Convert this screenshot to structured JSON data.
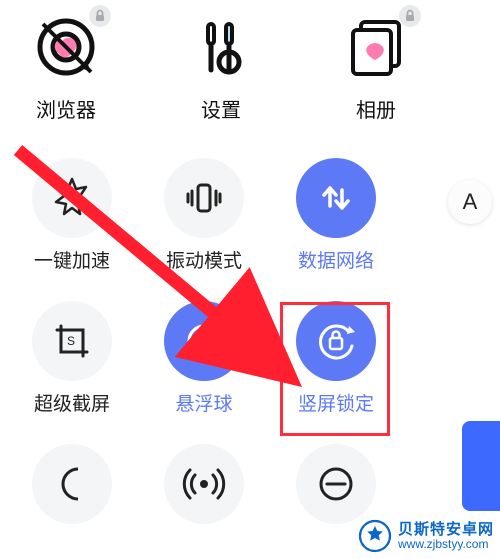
{
  "apps": {
    "browser": {
      "label": "浏览器",
      "locked": true
    },
    "settings": {
      "label": "设置",
      "locked": false
    },
    "gallery": {
      "label": "相册",
      "locked": true
    }
  },
  "toggles": {
    "boost": {
      "label": "一键加速",
      "active": false
    },
    "vibrate": {
      "label": "振动模式",
      "active": false
    },
    "data": {
      "label": "数据网络",
      "active": true
    },
    "screenshot": {
      "label": "超级截屏",
      "active": false
    },
    "float": {
      "label": "悬浮球",
      "active": true
    },
    "portrait": {
      "label": "竖屏锁定",
      "active": true
    }
  },
  "font_button": {
    "label": "A"
  },
  "watermark": {
    "title": "贝斯特安卓网",
    "url": "www.zjbstyy.com"
  }
}
